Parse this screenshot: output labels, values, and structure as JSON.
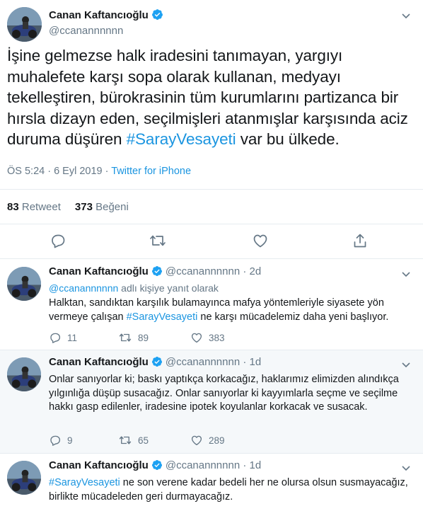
{
  "main_tweet": {
    "author_name": "Canan Kaftancıoğlu",
    "handle": "@ccanannnnnn",
    "text_before_hashtag": "İşine gelmezse halk iradesini tanımayan, yargıyı muhalefete karşı sopa olarak kullanan, medyayı tekelleştiren, bürokrasinin tüm kurumlarını partizanca bir hırsla dizayn eden, seçilmişleri atanmışlar karşısında aciz duruma düşüren ",
    "hashtag": "#SarayVesayeti",
    "text_after_hashtag": " var bu ülkede.",
    "timestamp": "ÖS 5:24 · 6 Eyl 2019",
    "separator": " · ",
    "source": "Twitter for iPhone",
    "retweet_count": "83",
    "retweet_label": "Retweet",
    "like_count": "373",
    "like_label": "Beğeni"
  },
  "replies": [
    {
      "author_name": "Canan Kaftancıoğlu",
      "handle": "@ccanannnnnn",
      "time": "· 2d",
      "reply_to_mention": "@ccanannnnnn",
      "reply_to_suffix": " adlı kişiye yanıt olarak",
      "text_before_hashtag": "Halktan, sandıktan karşılık bulamayınca mafya yöntemleriyle siyasete yön vermeye çalışan ",
      "hashtag": "#SarayVesayeti",
      "text_after_hashtag": " ne karşı mücadelemiz daha yeni başlıyor.",
      "reply_count": "11",
      "retweet_count": "89",
      "like_count": "383"
    },
    {
      "author_name": "Canan Kaftancıoğlu",
      "handle": "@ccanannnnnn",
      "time": "· 1d",
      "text": "Onlar sanıyorlar ki; baskı yaptıkça korkacağız, haklarımız elimizden alındıkça yılgınlığa düşüp susacağız. Onlar sanıyorlar ki kayyımlarla seçme ve seçilme hakkı gasp edilenler, iradesine ipotek koyulanlar korkacak ve susacak.",
      "reply_count": "9",
      "retweet_count": "65",
      "like_count": "289"
    },
    {
      "author_name": "Canan Kaftancıoğlu",
      "handle": "@ccanannnnnn",
      "time": "· 1d",
      "hashtag": "#SarayVesayeti",
      "text_after_hashtag": " ne son verene kadar bedeli her ne olursa olsun susmayacağız, birlikte mücadeleden geri durmayacağız."
    }
  ],
  "colors": {
    "text": "#14171a",
    "secondary": "#657786",
    "link": "#1b95e0",
    "divider": "#e6ecf0",
    "thread_bg": "#f5f8fa"
  },
  "icons": [
    "verified-badge-icon",
    "chevron-down-icon",
    "reply-icon",
    "retweet-icon",
    "like-icon",
    "share-icon"
  ]
}
